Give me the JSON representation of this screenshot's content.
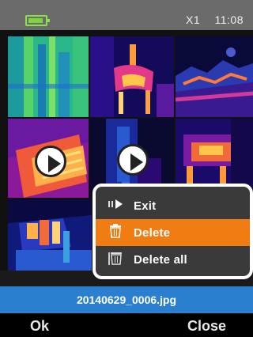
{
  "statusbar": {
    "battery_icon": "battery-icon",
    "battery_color": "#8ee04a",
    "mode": "X1",
    "time": "11:08"
  },
  "gallery": {
    "play_icon": "play-icon"
  },
  "context_menu": {
    "items": [
      {
        "label": "Exit",
        "icon": "exit-icon",
        "selected": false
      },
      {
        "label": "Delete",
        "icon": "trash-icon",
        "selected": true
      },
      {
        "label": "Delete all",
        "icon": "trash-all-icon",
        "selected": false
      }
    ],
    "selected_color": "#f07c12"
  },
  "file": {
    "name": "20140629_0006.jpg",
    "bar_color": "#2b7fcf"
  },
  "softkeys": {
    "left": "Ok",
    "right": "Close"
  }
}
